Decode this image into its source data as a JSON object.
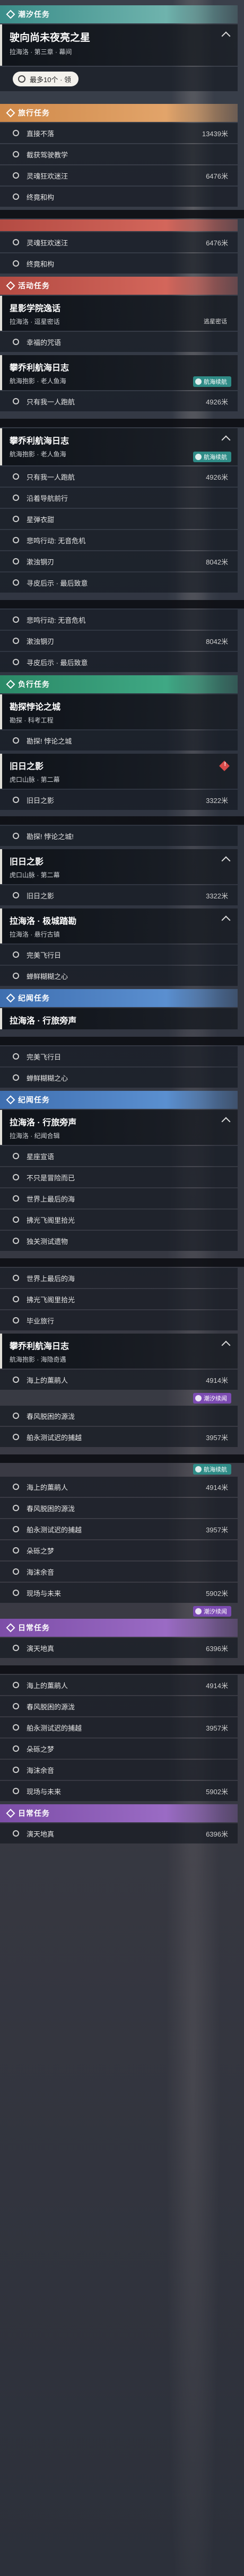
{
  "sections": {
    "tide": "潮汐任务",
    "journey": "旅行任务",
    "activity": "活动任务",
    "side": "负行任务",
    "chronicle": "纪闻任务",
    "daily": "日常任务"
  },
  "cards": {
    "main1": {
      "title": "驶向尚未夜亮之星",
      "sub": "拉海洛 · 第三章 · 幕间"
    },
    "star": {
      "title": "星影学院逸话",
      "sub": "拉海洛 · 逗星密话"
    },
    "log1": {
      "title": "攀乔利航海日志",
      "sub": "航海抱影 · 老人鱼海"
    },
    "explore": {
      "title": "勘探悖论之城",
      "sub": "勘探 · 科考工程"
    },
    "old": {
      "title": "旧日之影",
      "sub": "虎口山脉 · 第二幕"
    },
    "lahai": {
      "title": "拉海洛 · 极城踏勘",
      "sub": "拉海洛 · 悬行古镇"
    },
    "walk": {
      "title": "拉海洛 · 行旅旁声",
      "sub": "拉海洛 · 纪闻合辑"
    },
    "log2": {
      "title": "攀乔利航海日志",
      "sub": "航海抱影 · 海隐奇遇"
    }
  },
  "pill": {
    "label": "最多10个 · 领"
  },
  "rows": {
    "r1": "直接不落",
    "d1": "13439米",
    "r2": "截获驾驶教学",
    "r3": "灵魂狂欢迷汪",
    "d3": "6476米",
    "r4": "终竟和构",
    "r5": "灵魂狂欢迷汪",
    "d5": "6476米",
    "r6": "终竟和构",
    "r7": "幸福的咒语",
    "r8": "只有我一人跑航",
    "d8": "4926米",
    "r9": "只有我一人跑航",
    "d9": "4926米",
    "r10": "沿着导航前行",
    "r11": "星弹衣甜",
    "r12": "悲鸣行动: 无音危机",
    "r13": "漱浊钢刃",
    "d13": "8042米",
    "r14": "寻皮后示 · 最后致意",
    "r15": "悲鸣行动: 无音危机",
    "r16": "漱浊钢刃",
    "d16": "8042米",
    "r17": "寻皮后示 · 最后致意",
    "r18": "勘探! 悖论之城",
    "r19": "旧日之影",
    "d19": "3322米",
    "r20": "勘探! 悖论之城!",
    "r21": "旧日之影",
    "d21": "3322米",
    "r22": "完美飞行日",
    "r23": "蝉鲜糊糊之心",
    "r24": "完美飞行日",
    "r25": "蝉鲜糊糊之心",
    "r26": "星座宣语",
    "r27": "不只是冒险而已",
    "r28": "世界上最后的海",
    "r29": "拂光飞阁里拾光",
    "r30": "独关测试遗物",
    "r31": "世界上最后的海",
    "r32": "拂光飞阁里拾光",
    "r33": "毕业旅行",
    "r34": "海上的薰鹃人",
    "d34": "4914米",
    "r35": "春风脱困的源泷",
    "r36": "舶永测试迟的捕越",
    "d36": "3957米",
    "r37": "海上的薰鹃人",
    "d37": "4914米",
    "r38": "春风脱困的源泷",
    "r39": "舶永测试迟的捕越",
    "d39": "3957米",
    "r40": "朵砾之梦",
    "r41": "海沫余音",
    "r42": "现场与未来",
    "d42": "5902米",
    "r43": "演天地真",
    "d43": "6396米",
    "r44": "海上的薰鹃人",
    "d44": "4914米",
    "r45": "春风脱困的源泷",
    "r46": "舶永测试迟的捕越",
    "d46": "3957米",
    "r47": "朵砾之梦",
    "r48": "海沫余音",
    "r49": "现场与未来",
    "d49": "5902米",
    "r50": "演天地真",
    "d50": "6396米"
  },
  "badges": {
    "nav": "航海续航",
    "tide": "潮汐续闻",
    "pass": "逃星密话"
  }
}
